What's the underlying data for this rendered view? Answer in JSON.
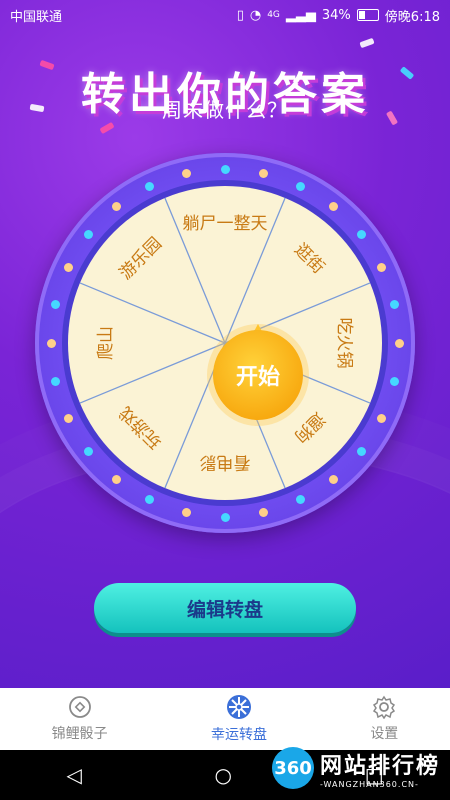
{
  "status": {
    "carrier": "中国联通",
    "network": "4G",
    "battery": "34%",
    "time": "傍晚6:18"
  },
  "hero": {
    "title": "转出你的答案",
    "subtitle": "周末做什么？"
  },
  "wheel": {
    "segments": [
      "躺尸一整天",
      "逛街",
      "吃火锅",
      "遛狗",
      "看电影",
      "玩游戏",
      "爬山",
      "游乐园"
    ],
    "start_label": "开始"
  },
  "actions": {
    "edit_label": "编辑转盘"
  },
  "tabs": [
    {
      "label": "锦鲤骰子",
      "icon": "dice-icon",
      "active": false
    },
    {
      "label": "幸运转盘",
      "icon": "wheel-icon",
      "active": true
    },
    {
      "label": "设置",
      "icon": "gear-icon",
      "active": false
    }
  ],
  "nav": {
    "back": "◁",
    "home": "○",
    "recent": "□"
  },
  "watermark": {
    "logo": "360",
    "main": "网站排行榜",
    "sub": "-WANGZHAN360.CN-"
  }
}
